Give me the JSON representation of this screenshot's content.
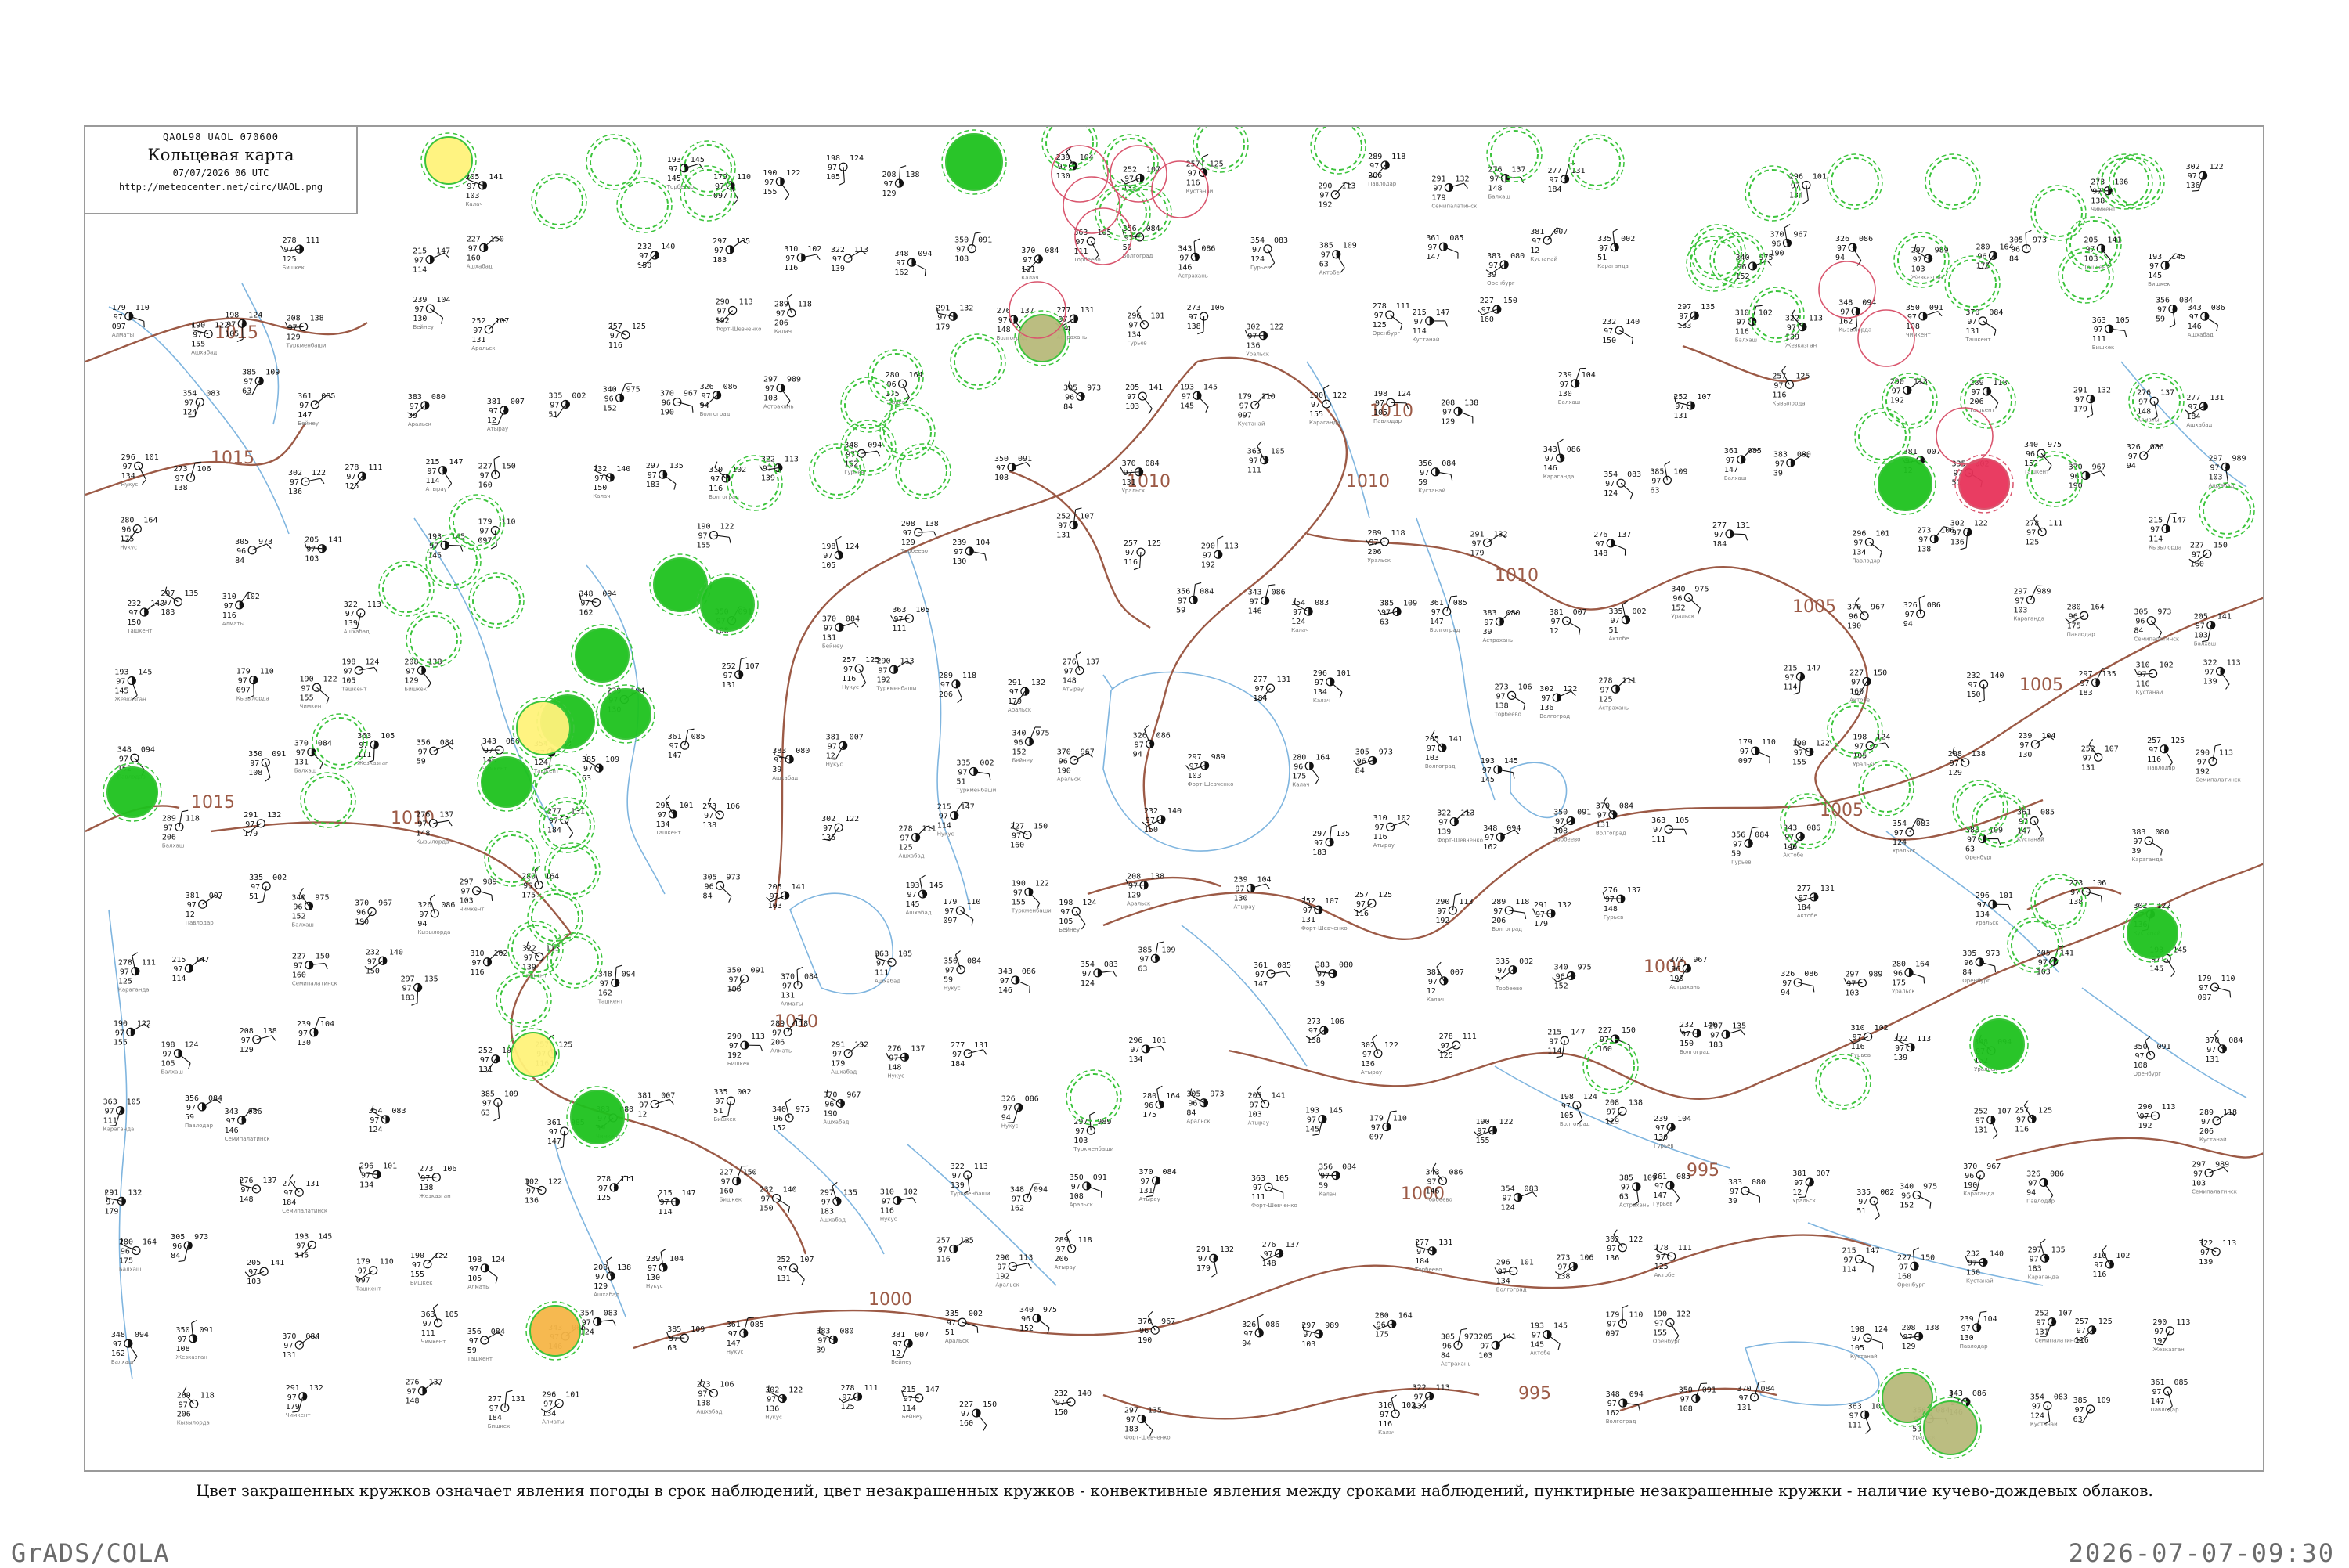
{
  "header": {
    "codes": "QAOL98  UAOL  070600",
    "title": "Кольцевая карта",
    "date": "07/07/2026 06 UTC",
    "url": "http://meteocenter.net/circ/UAOL.png"
  },
  "caption": "Цвет закрашенных кружков означает явления погоды в срок наблюдений, цвет незакрашенных кружков - конвективные явления между сроками наблюдений, пунктирные незакрашенные кружки - наличие кучево-дождевых облаков.",
  "footer": {
    "left": "GrADS/COLA",
    "right": "2026-07-07-09:30"
  },
  "colors": {
    "isobar": "#9c5a46",
    "river": "#7fb5df",
    "rain_fill": "#1ec21e",
    "cb_dashed": "#3cc43c",
    "convective_ring": "#d9566e",
    "thunder_fill": "#e8335a",
    "haze_fill": "#fff27a",
    "dust_fill": "#f5b547",
    "fog_fill": "#b7b97a"
  },
  "isobars": {
    "labels": [
      "1015",
      "1015",
      "1015",
      "1010",
      "1010",
      "1010",
      "1010",
      "1010",
      "1010",
      "1005",
      "1005",
      "1005",
      "1000",
      "1000",
      "1000",
      "1000",
      "995",
      "995"
    ]
  },
  "map": {
    "station_readings": [
      {
        "t": "205",
        "p": "141",
        "w": "97",
        "q": "103"
      },
      {
        "t": "193",
        "p": "145",
        "w": "97",
        "q": "145"
      },
      {
        "t": "179",
        "p": "110",
        "w": "97",
        "q": "097"
      },
      {
        "t": "190",
        "p": "122",
        "w": "97",
        "q": "155"
      },
      {
        "t": "198",
        "p": "124",
        "w": "97",
        "q": "105"
      },
      {
        "t": "208",
        "p": "138",
        "w": "97",
        "q": "129"
      },
      {
        "t": "239",
        "p": "104",
        "w": "97",
        "q": "130"
      },
      {
        "t": "252",
        "p": "107",
        "w": "97",
        "q": "131"
      },
      {
        "t": "257",
        "p": "125",
        "w": "97",
        "q": "116"
      },
      {
        "t": "290",
        "p": "113",
        "w": "97",
        "q": "192"
      },
      {
        "t": "289",
        "p": "118",
        "w": "97",
        "q": "206"
      },
      {
        "t": "291",
        "p": "132",
        "w": "97",
        "q": "179"
      },
      {
        "t": "276",
        "p": "137",
        "w": "97",
        "q": "148"
      },
      {
        "t": "277",
        "p": "131",
        "w": "97",
        "q": "184"
      },
      {
        "t": "296",
        "p": "101",
        "w": "97",
        "q": "134"
      },
      {
        "t": "273",
        "p": "106",
        "w": "97",
        "q": "138"
      },
      {
        "t": "302",
        "p": "122",
        "w": "97",
        "q": "136"
      },
      {
        "t": "278",
        "p": "111",
        "w": "97",
        "q": "125"
      },
      {
        "t": "215",
        "p": "147",
        "w": "97",
        "q": "114"
      },
      {
        "t": "227",
        "p": "150",
        "w": "97",
        "q": "160"
      },
      {
        "t": "232",
        "p": "140",
        "w": "97",
        "q": "150"
      },
      {
        "t": "297",
        "p": "135",
        "w": "97",
        "q": "183"
      },
      {
        "t": "310",
        "p": "102",
        "w": "97",
        "q": "116"
      },
      {
        "t": "322",
        "p": "113",
        "w": "97",
        "q": "139"
      },
      {
        "t": "348",
        "p": "094",
        "w": "97",
        "q": "162"
      },
      {
        "t": "350",
        "p": "091",
        "w": "97",
        "q": "108"
      },
      {
        "t": "370",
        "p": "084",
        "w": "97",
        "q": "131"
      },
      {
        "t": "363",
        "p": "105",
        "w": "97",
        "q": "111"
      },
      {
        "t": "356",
        "p": "084",
        "w": "97",
        "q": "59"
      },
      {
        "t": "343",
        "p": "086",
        "w": "97",
        "q": "146"
      },
      {
        "t": "354",
        "p": "083",
        "w": "97",
        "q": "124"
      },
      {
        "t": "385",
        "p": "109",
        "w": "97",
        "q": "63"
      },
      {
        "t": "361",
        "p": "085",
        "w": "97",
        "q": "147"
      },
      {
        "t": "383",
        "p": "080",
        "w": "97",
        "q": "39"
      },
      {
        "t": "381",
        "p": "007",
        "w": "97",
        "q": "12"
      },
      {
        "t": "335",
        "p": "002",
        "w": "97",
        "q": "51"
      },
      {
        "t": "340",
        "p": "975",
        "w": "96",
        "q": "152"
      },
      {
        "t": "370",
        "p": "967",
        "w": "96",
        "q": "190"
      },
      {
        "t": "326",
        "p": "086",
        "w": "97",
        "q": "94"
      },
      {
        "t": "297",
        "p": "989",
        "w": "97",
        "q": "103"
      },
      {
        "t": "280",
        "p": "164",
        "w": "96",
        "q": "175"
      },
      {
        "t": "305",
        "p": "973",
        "w": "96",
        "q": "84"
      }
    ],
    "station_names": [
      "Калач",
      "Торбеево",
      "Волгоград",
      "Астрахань",
      "Гурьев",
      "Актобе",
      "Уральск",
      "Оренбург",
      "Кустанай",
      "Караганда",
      "Павлодар",
      "Семипалатинск",
      "Балхаш",
      "Жезказган",
      "Кызылорда",
      "Чимкент",
      "Ташкент",
      "Бишкек",
      "Алматы",
      "Ашхабад",
      "Нукус",
      "Туркменбаши",
      "Бейнеу",
      "Аральск",
      "Атырау",
      "Форт-Шевченко"
    ]
  }
}
